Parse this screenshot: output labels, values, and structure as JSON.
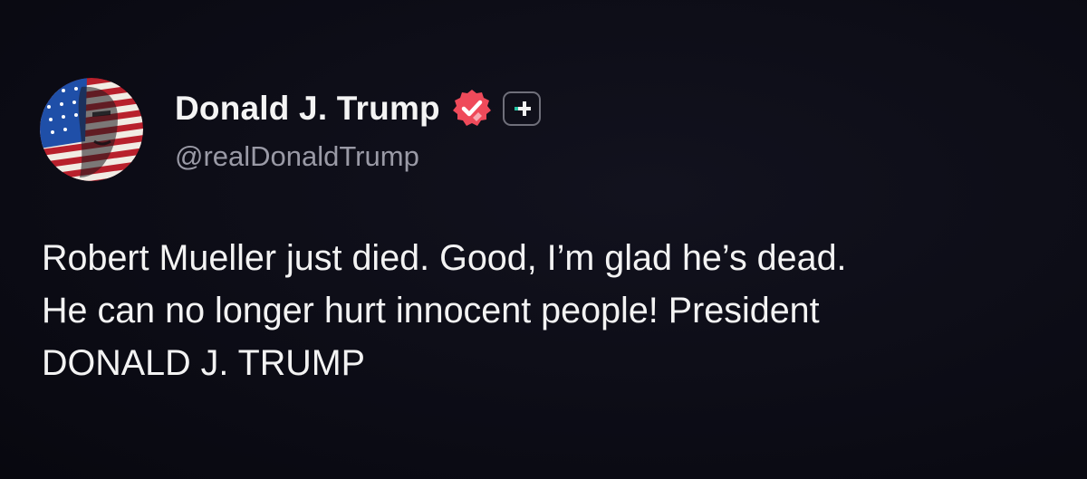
{
  "post": {
    "author": {
      "display_name": "Donald J. Trump",
      "handle": "@realDonaldTrump",
      "verified": true,
      "avatar_icon": "flag-portrait-avatar-icon"
    },
    "badges": {
      "verified_icon": "verified-check-badge-icon",
      "verified_color": "#ef4a5a",
      "plus_icon": "plus-add-icon",
      "plus_accent": "#27c5a6"
    },
    "text_lines": [
      "Robert Mueller just died. Good, I’m glad he’s dead.",
      "He can no longer hurt innocent people! President",
      "DONALD J. TRUMP"
    ]
  },
  "colors": {
    "background": "#0d0d17",
    "text": "#f3f3f3",
    "muted": "#9a9aa6"
  }
}
